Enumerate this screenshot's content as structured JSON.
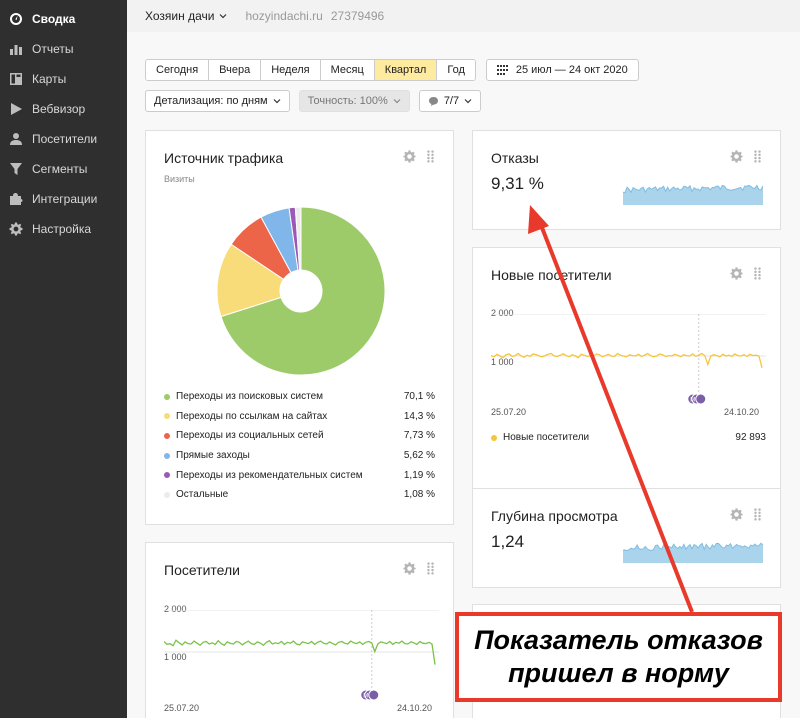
{
  "sidebar": {
    "items": [
      {
        "label": "Сводка",
        "icon": "gauge-icon",
        "active": true
      },
      {
        "label": "Отчеты",
        "icon": "bar-chart-icon"
      },
      {
        "label": "Карты",
        "icon": "map-icon"
      },
      {
        "label": "Вебвизор",
        "icon": "play-icon"
      },
      {
        "label": "Посетители",
        "icon": "user-icon"
      },
      {
        "label": "Сегменты",
        "icon": "filter-icon"
      },
      {
        "label": "Интеграции",
        "icon": "puzzle-icon"
      },
      {
        "label": "Настройка",
        "icon": "gear-icon"
      }
    ]
  },
  "header": {
    "counter_name": "Хозяин дачи",
    "counter_url": "hozyindachi.ru",
    "counter_id": "27379496"
  },
  "toolbar": {
    "periods": [
      "Сегодня",
      "Вчера",
      "Неделя",
      "Месяц",
      "Квартал",
      "Год"
    ],
    "active_period": "Квартал",
    "date_range": "25 июл — 24 окт 2020",
    "detail": "Детализация: по дням",
    "accuracy": "Точность: 100%",
    "segments": "7/7"
  },
  "traffic": {
    "title": "Источник трафика",
    "subtitle": "Визиты",
    "legend": [
      {
        "label": "Переходы из поисковых систем",
        "value": "70,1 %",
        "color": "#9dcb6a"
      },
      {
        "label": "Переходы по ссылкам на сайтах",
        "value": "14,3 %",
        "color": "#f8dc7a"
      },
      {
        "label": "Переходы из социальных сетей",
        "value": "7,73 %",
        "color": "#ec6549"
      },
      {
        "label": "Прямые заходы",
        "value": "5,62 %",
        "color": "#80b6ea"
      },
      {
        "label": "Переходы из рекомендательных систем",
        "value": "1,19 %",
        "color": "#9b59b6"
      },
      {
        "label": "Остальные",
        "value": "1,08 %",
        "color": "#ececec"
      }
    ]
  },
  "bounce": {
    "title": "Отказы",
    "value": "9,31 %"
  },
  "new_visitors": {
    "title": "Новые посетители",
    "y_top": "2 000",
    "y_mid": "1 000",
    "date_start": "25.07.20",
    "date_end": "24.10.20",
    "legend_label": "Новые посетители",
    "legend_value": "92 893",
    "line_color": "#f5c53b"
  },
  "depth": {
    "title": "Глубина просмотра",
    "value": "1,24"
  },
  "visitors": {
    "title": "Посетители",
    "y_top": "2 000",
    "y_mid": "1 000",
    "date_start": "25.07.20",
    "date_end": "24.10.20",
    "line_color": "#7cc24a"
  },
  "marker_label": "M",
  "callout": {
    "line1": "Показатель отказов",
    "line2": "пришел в норму"
  },
  "chart_data": [
    {
      "type": "pie",
      "title": "Источник трафика",
      "categories": [
        "Переходы из поисковых систем",
        "Переходы по ссылкам на сайтах",
        "Переходы из социальных сетей",
        "Прямые заходы",
        "Переходы из рекомендательных систем",
        "Остальные"
      ],
      "values": [
        70.1,
        14.3,
        7.73,
        5.62,
        1.19,
        1.08
      ]
    },
    {
      "type": "line",
      "title": "Новые посетители",
      "x": [
        "25.07.20",
        "24.10.20"
      ],
      "ylim": [
        0,
        2000
      ],
      "series": [
        {
          "name": "Новые посетители",
          "values": [
            1010,
            980,
            1040,
            1000,
            960,
            1030,
            1050,
            990,
            1010,
            1060,
            1000,
            970,
            1020,
            990,
            1050,
            1030,
            1000,
            980,
            1010,
            1040,
            1060,
            1000,
            990,
            1020,
            1050,
            1010,
            980,
            1030,
            1000,
            960,
            1040,
            1020,
            990,
            1010,
            1000,
            1050,
            1030,
            980,
            1010,
            1040,
            1000,
            990,
            1060,
            1020,
            1000,
            980,
            1030,
            1010,
            1000,
            1040,
            990,
            1020,
            1060,
            1010,
            980,
            1000,
            1050,
            1030,
            990,
            1010,
            1000,
            1040,
            1020,
            980,
            1030,
            1010,
            1000,
            1050,
            990,
            1020,
            1060,
            1010,
            800,
            1000,
            1030,
            1010,
            980,
            1040,
            1000,
            1020,
            990,
            1050,
            1010,
            1000,
            1030,
            990,
            1040,
            1010,
            1020,
            1000,
            720
          ]
        }
      ]
    },
    {
      "type": "line",
      "title": "Посетители",
      "x": [
        "25.07.20",
        "24.10.20"
      ],
      "ylim": [
        0,
        2000
      ],
      "series": [
        {
          "name": "",
          "values": [
            1250,
            1180,
            1200,
            1150,
            1280,
            1220,
            1170,
            1240,
            1200,
            1190,
            1260,
            1210,
            1160,
            1230,
            1250,
            1190,
            1220,
            1180,
            1270,
            1200,
            1160,
            1240,
            1210,
            1190,
            1250,
            1230,
            1170,
            1220,
            1260,
            1200,
            1180,
            1240,
            1210,
            1160,
            1230,
            1270,
            1190,
            1220,
            1200,
            1250,
            1180,
            1230,
            1210,
            1260,
            1190,
            1170,
            1240,
            1220,
            1200,
            1250,
            1180,
            1230,
            1260,
            1210,
            1190,
            1240,
            1200,
            1170,
            1230,
            1250,
            1210,
            1190,
            1260,
            1220,
            1200,
            1240,
            1180,
            1230,
            1250,
            1210,
            1010,
            1190,
            1240,
            1220,
            1200,
            1250,
            1180,
            1230,
            1210,
            1260,
            1200,
            1190,
            1240,
            1220,
            1180,
            1250,
            1210,
            1200,
            1230,
            1190,
            700
          ]
        }
      ]
    }
  ]
}
